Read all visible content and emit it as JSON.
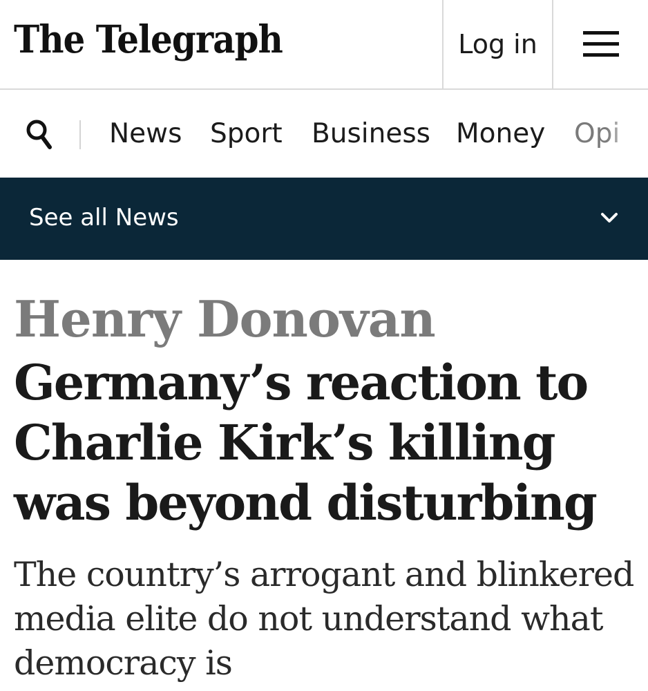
{
  "masthead": {
    "logo_text": "The Telegraph",
    "login_label": "Log in",
    "menu_icon": "hamburger-menu-icon"
  },
  "section_nav": {
    "search_icon": "search-icon",
    "items": [
      {
        "label": "News"
      },
      {
        "label": "Sport"
      },
      {
        "label": "Business"
      },
      {
        "label": "Money"
      },
      {
        "label": "Opi"
      }
    ]
  },
  "subnav": {
    "label": "See all News",
    "icon": "chevron-down-icon",
    "background": "#0b2738"
  },
  "article": {
    "author": "Henry Donovan",
    "headline_lines": [
      "Germany’s reaction to",
      "Charlie Kirk’s killing",
      "was beyond disturbing"
    ],
    "standfirst_lines": [
      "The country’s arrogant and blinkered",
      "media elite do not understand what",
      "democracy is"
    ]
  }
}
